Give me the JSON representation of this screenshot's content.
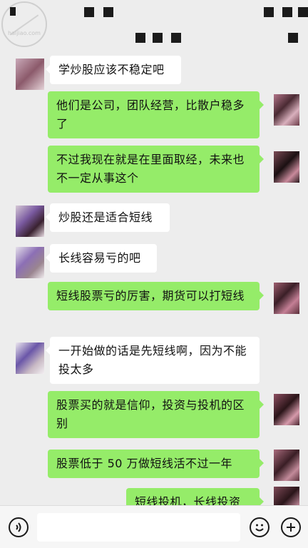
{
  "watermark": {
    "text": "haijiao.com"
  },
  "messages": [
    {
      "side": "in",
      "text": "学炒股应该不稳定吧"
    },
    {
      "side": "out",
      "text": "他们是公司，团队经营，比散户稳多了"
    },
    {
      "side": "out",
      "text": "不过我现在就是在里面取经，未来也不一定从事这个"
    },
    {
      "side": "in",
      "text": "炒股还是适合短线"
    },
    {
      "side": "in",
      "text": "长线容易亏的吧"
    },
    {
      "side": "out",
      "text": "短线股票亏的厉害，期货可以打短线"
    },
    {
      "side": "in",
      "text": "一开始做的话是先短线啊，因为不能投太多"
    },
    {
      "side": "out",
      "text": "股票买的就是信仰，投资与投机的区别"
    },
    {
      "side": "out",
      "text": "股票低于 50 万做短线活不过一年"
    },
    {
      "side": "out",
      "text": "短线投机，长线投资"
    }
  ],
  "input_bar": {
    "voice_icon": "voice-icon",
    "emoji_icon": "emoji-icon",
    "plus_icon": "plus-icon",
    "message_value": ""
  },
  "colors": {
    "background": "#ededed",
    "outgoing_bubble": "#95ec69",
    "incoming_bubble": "#ffffff"
  }
}
